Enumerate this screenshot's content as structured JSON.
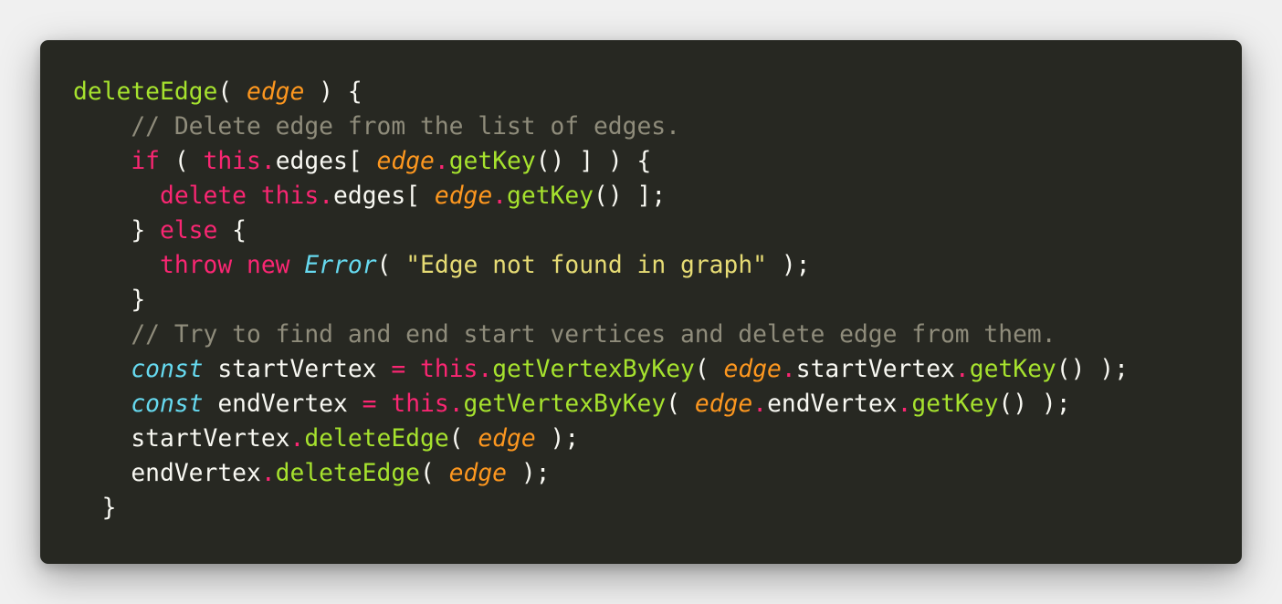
{
  "theme": {
    "page_background": "#f0f0f0",
    "editor_background": "#272822",
    "colors": {
      "plain": "#f8f8f2",
      "function": "#a6e22e",
      "parameter": "#fd971f",
      "comment": "#8f8c7b",
      "keyword": "#f92672",
      "storage": "#66d9ef",
      "class": "#66d9ef",
      "string": "#e6db74",
      "operator": "#f92672"
    }
  },
  "code": {
    "language": "javascript",
    "lines": [
      [
        {
          "t": "deleteEdge",
          "k": "func"
        },
        {
          "t": "( ",
          "k": "plain"
        },
        {
          "t": "edge",
          "k": "param"
        },
        {
          "t": " ) {",
          "k": "plain"
        }
      ],
      [
        {
          "t": "    ",
          "k": "plain"
        },
        {
          "t": "// Delete edge from the list of edges.",
          "k": "comment"
        }
      ],
      [
        {
          "t": "    ",
          "k": "plain"
        },
        {
          "t": "if",
          "k": "keyword"
        },
        {
          "t": " ( ",
          "k": "plain"
        },
        {
          "t": "this",
          "k": "keyword"
        },
        {
          "t": ".",
          "k": "op"
        },
        {
          "t": "edges[ ",
          "k": "plain"
        },
        {
          "t": "edge",
          "k": "param"
        },
        {
          "t": ".",
          "k": "op"
        },
        {
          "t": "getKey",
          "k": "func"
        },
        {
          "t": "() ] ) {",
          "k": "plain"
        }
      ],
      [
        {
          "t": "      ",
          "k": "plain"
        },
        {
          "t": "delete",
          "k": "keyword"
        },
        {
          "t": " ",
          "k": "plain"
        },
        {
          "t": "this",
          "k": "keyword"
        },
        {
          "t": ".",
          "k": "op"
        },
        {
          "t": "edges[ ",
          "k": "plain"
        },
        {
          "t": "edge",
          "k": "param"
        },
        {
          "t": ".",
          "k": "op"
        },
        {
          "t": "getKey",
          "k": "func"
        },
        {
          "t": "() ];",
          "k": "plain"
        }
      ],
      [
        {
          "t": "    } ",
          "k": "plain"
        },
        {
          "t": "else",
          "k": "keyword"
        },
        {
          "t": " {",
          "k": "plain"
        }
      ],
      [
        {
          "t": "      ",
          "k": "plain"
        },
        {
          "t": "throw",
          "k": "keyword"
        },
        {
          "t": " ",
          "k": "plain"
        },
        {
          "t": "new",
          "k": "keyword"
        },
        {
          "t": " ",
          "k": "plain"
        },
        {
          "t": "Error",
          "k": "class"
        },
        {
          "t": "( ",
          "k": "plain"
        },
        {
          "t": "\"Edge not found in graph\"",
          "k": "string"
        },
        {
          "t": " );",
          "k": "plain"
        }
      ],
      [
        {
          "t": "    }",
          "k": "plain"
        }
      ],
      [
        {
          "t": "    ",
          "k": "plain"
        },
        {
          "t": "// Try to find and end start vertices and delete edge from them.",
          "k": "comment"
        }
      ],
      [
        {
          "t": "    ",
          "k": "plain"
        },
        {
          "t": "const",
          "k": "storage"
        },
        {
          "t": " startVertex ",
          "k": "plain"
        },
        {
          "t": "=",
          "k": "op"
        },
        {
          "t": " ",
          "k": "plain"
        },
        {
          "t": "this",
          "k": "keyword"
        },
        {
          "t": ".",
          "k": "op"
        },
        {
          "t": "getVertexByKey",
          "k": "func"
        },
        {
          "t": "( ",
          "k": "plain"
        },
        {
          "t": "edge",
          "k": "param"
        },
        {
          "t": ".",
          "k": "op"
        },
        {
          "t": "startVertex",
          "k": "plain"
        },
        {
          "t": ".",
          "k": "op"
        },
        {
          "t": "getKey",
          "k": "func"
        },
        {
          "t": "() );",
          "k": "plain"
        }
      ],
      [
        {
          "t": "    ",
          "k": "plain"
        },
        {
          "t": "const",
          "k": "storage"
        },
        {
          "t": " endVertex ",
          "k": "plain"
        },
        {
          "t": "=",
          "k": "op"
        },
        {
          "t": " ",
          "k": "plain"
        },
        {
          "t": "this",
          "k": "keyword"
        },
        {
          "t": ".",
          "k": "op"
        },
        {
          "t": "getVertexByKey",
          "k": "func"
        },
        {
          "t": "( ",
          "k": "plain"
        },
        {
          "t": "edge",
          "k": "param"
        },
        {
          "t": ".",
          "k": "op"
        },
        {
          "t": "endVertex",
          "k": "plain"
        },
        {
          "t": ".",
          "k": "op"
        },
        {
          "t": "getKey",
          "k": "func"
        },
        {
          "t": "() );",
          "k": "plain"
        }
      ],
      [
        {
          "t": "    startVertex",
          "k": "plain"
        },
        {
          "t": ".",
          "k": "op"
        },
        {
          "t": "deleteEdge",
          "k": "func"
        },
        {
          "t": "( ",
          "k": "plain"
        },
        {
          "t": "edge",
          "k": "param"
        },
        {
          "t": " );",
          "k": "plain"
        }
      ],
      [
        {
          "t": "    endVertex",
          "k": "plain"
        },
        {
          "t": ".",
          "k": "op"
        },
        {
          "t": "deleteEdge",
          "k": "func"
        },
        {
          "t": "( ",
          "k": "plain"
        },
        {
          "t": "edge",
          "k": "param"
        },
        {
          "t": " );",
          "k": "plain"
        }
      ],
      [
        {
          "t": "  }",
          "k": "plain"
        }
      ]
    ]
  }
}
